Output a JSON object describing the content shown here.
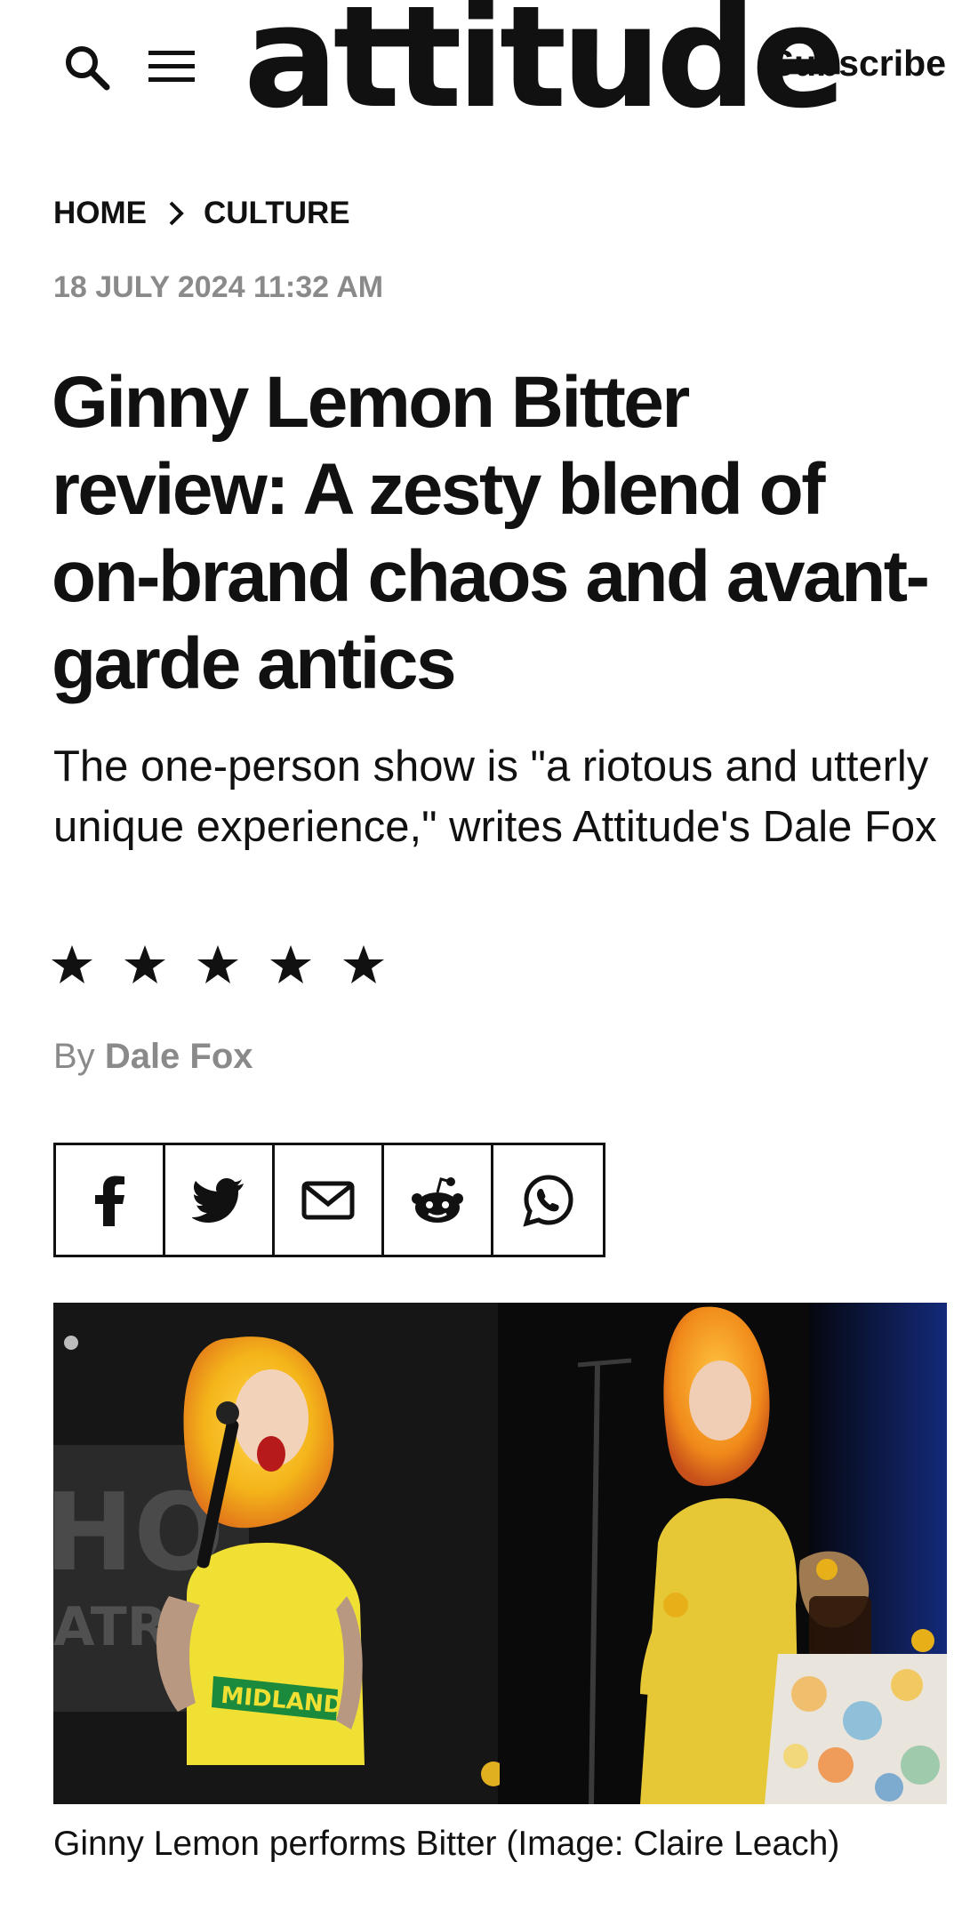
{
  "header": {
    "logo": "attitude",
    "subscribe_label": "Subscribe",
    "search_icon": "search-icon",
    "menu_icon": "hamburger-menu-icon"
  },
  "breadcrumb": {
    "items": [
      "HOME",
      "CULTURE"
    ],
    "separator_icon": "chevron-right-icon"
  },
  "article": {
    "date": "18 JULY 2024 11:32 AM",
    "headline": "Ginny Lemon Bitter review: A zesty blend of on-brand chaos and avant-garde antics",
    "dek": "The one-person show is \"a riotous and utterly unique experience,\" writes Attitude's Dale Fox",
    "rating": {
      "value": 5,
      "max": 5
    },
    "byline_prefix": "By",
    "author": "Dale Fox",
    "caption": "Ginny Lemon performs Bitter (Image: Claire Leach)",
    "photo_banner_text": "MIDLANDS"
  },
  "share": {
    "buttons": [
      "facebook-icon",
      "twitter-icon",
      "email-icon",
      "reddit-icon",
      "whatsapp-icon"
    ]
  },
  "colors": {
    "text": "#111111",
    "muted": "#8a8a8a",
    "background": "#ffffff"
  }
}
